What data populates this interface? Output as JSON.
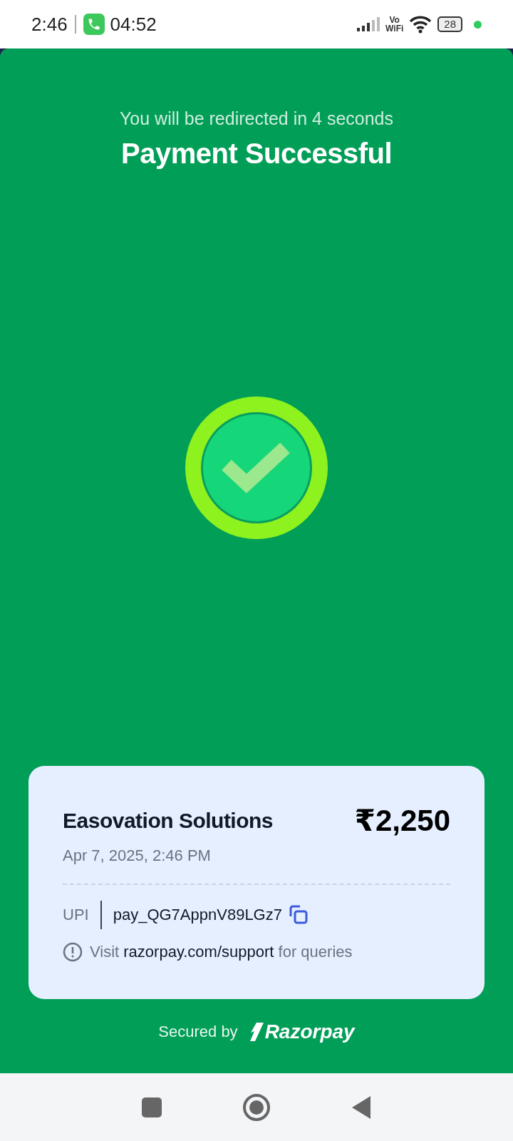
{
  "status_bar": {
    "time": "2:46",
    "call_time": "04:52",
    "network_label_top": "Vo",
    "network_label_bottom": "WiFi",
    "battery": "28"
  },
  "header": {
    "redirect_text": "You will be redirected in 4 seconds",
    "title": "Payment Successful"
  },
  "card": {
    "merchant": "Easovation Solutions",
    "amount": "₹2,250",
    "datetime": "Apr 7, 2025, 2:46 PM",
    "method_label": "UPI",
    "payment_id": "pay_QG7AppnV89LGz7",
    "support": {
      "prefix": "Visit",
      "link": "razorpay.com/support",
      "suffix": "for queries"
    }
  },
  "footer": {
    "secured_by": "Secured by",
    "brand": "Razorpay"
  }
}
